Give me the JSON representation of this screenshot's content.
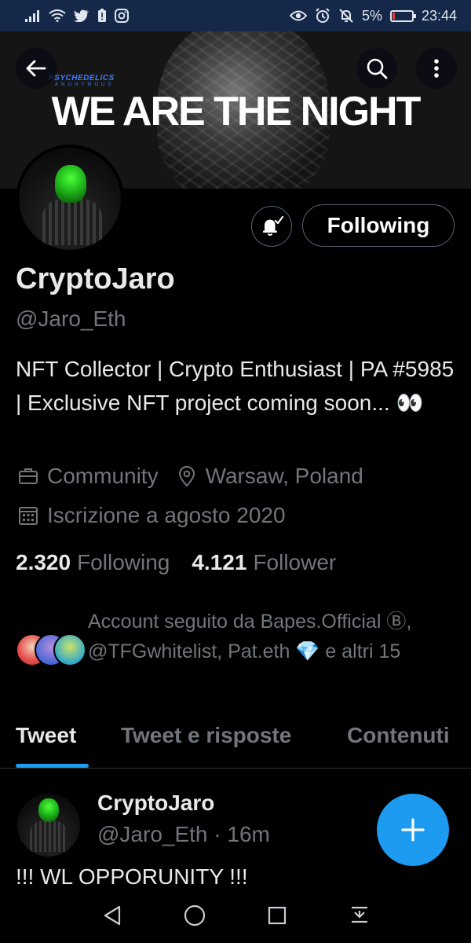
{
  "status_bar": {
    "battery_percent": "5%",
    "time": "23:44"
  },
  "banner": {
    "brand": "PSYCHEDELICS",
    "brand_sub": "ANONYMOUS",
    "title": "WE ARE THE NIGHT"
  },
  "profile": {
    "following_button": "Following",
    "name": "CryptoJaro",
    "handle": "@Jaro_Eth",
    "bio": "NFT Collector | Crypto Enthusiast | PA #5985 | Exclusive NFT project coming soon... 👀",
    "category": "Community",
    "location": "Warsaw, Poland",
    "joined": "Iscrizione a agosto 2020",
    "following_count": "2.320",
    "following_label": "Following",
    "followers_count": "4.121",
    "followers_label": "Follower",
    "followed_by": "Account seguito da Bapes.Official Ⓑ, @TFGwhitelist, Pat.eth 💎 e altri 15"
  },
  "tabs": [
    {
      "label": "Tweet",
      "active": true
    },
    {
      "label": "Tweet e risposte",
      "active": false
    },
    {
      "label": "Contenuti",
      "active": false
    }
  ],
  "tweet": {
    "name": "CryptoJaro",
    "handle_time": "@Jaro_Eth · 16m",
    "text": "!!! WL OPPORUNITY !!!"
  },
  "colors": {
    "accent": "#1d9bf0",
    "background": "#000000",
    "secondary_text": "#71767b",
    "status_bar": "#15284a"
  },
  "icons": {
    "back": "arrow-left-icon",
    "search": "search-icon",
    "more": "more-vertical-icon",
    "bell": "notification-bell-icon",
    "category": "briefcase-icon",
    "location": "location-pin-icon",
    "joined": "calendar-icon",
    "compose": "plus-icon"
  }
}
